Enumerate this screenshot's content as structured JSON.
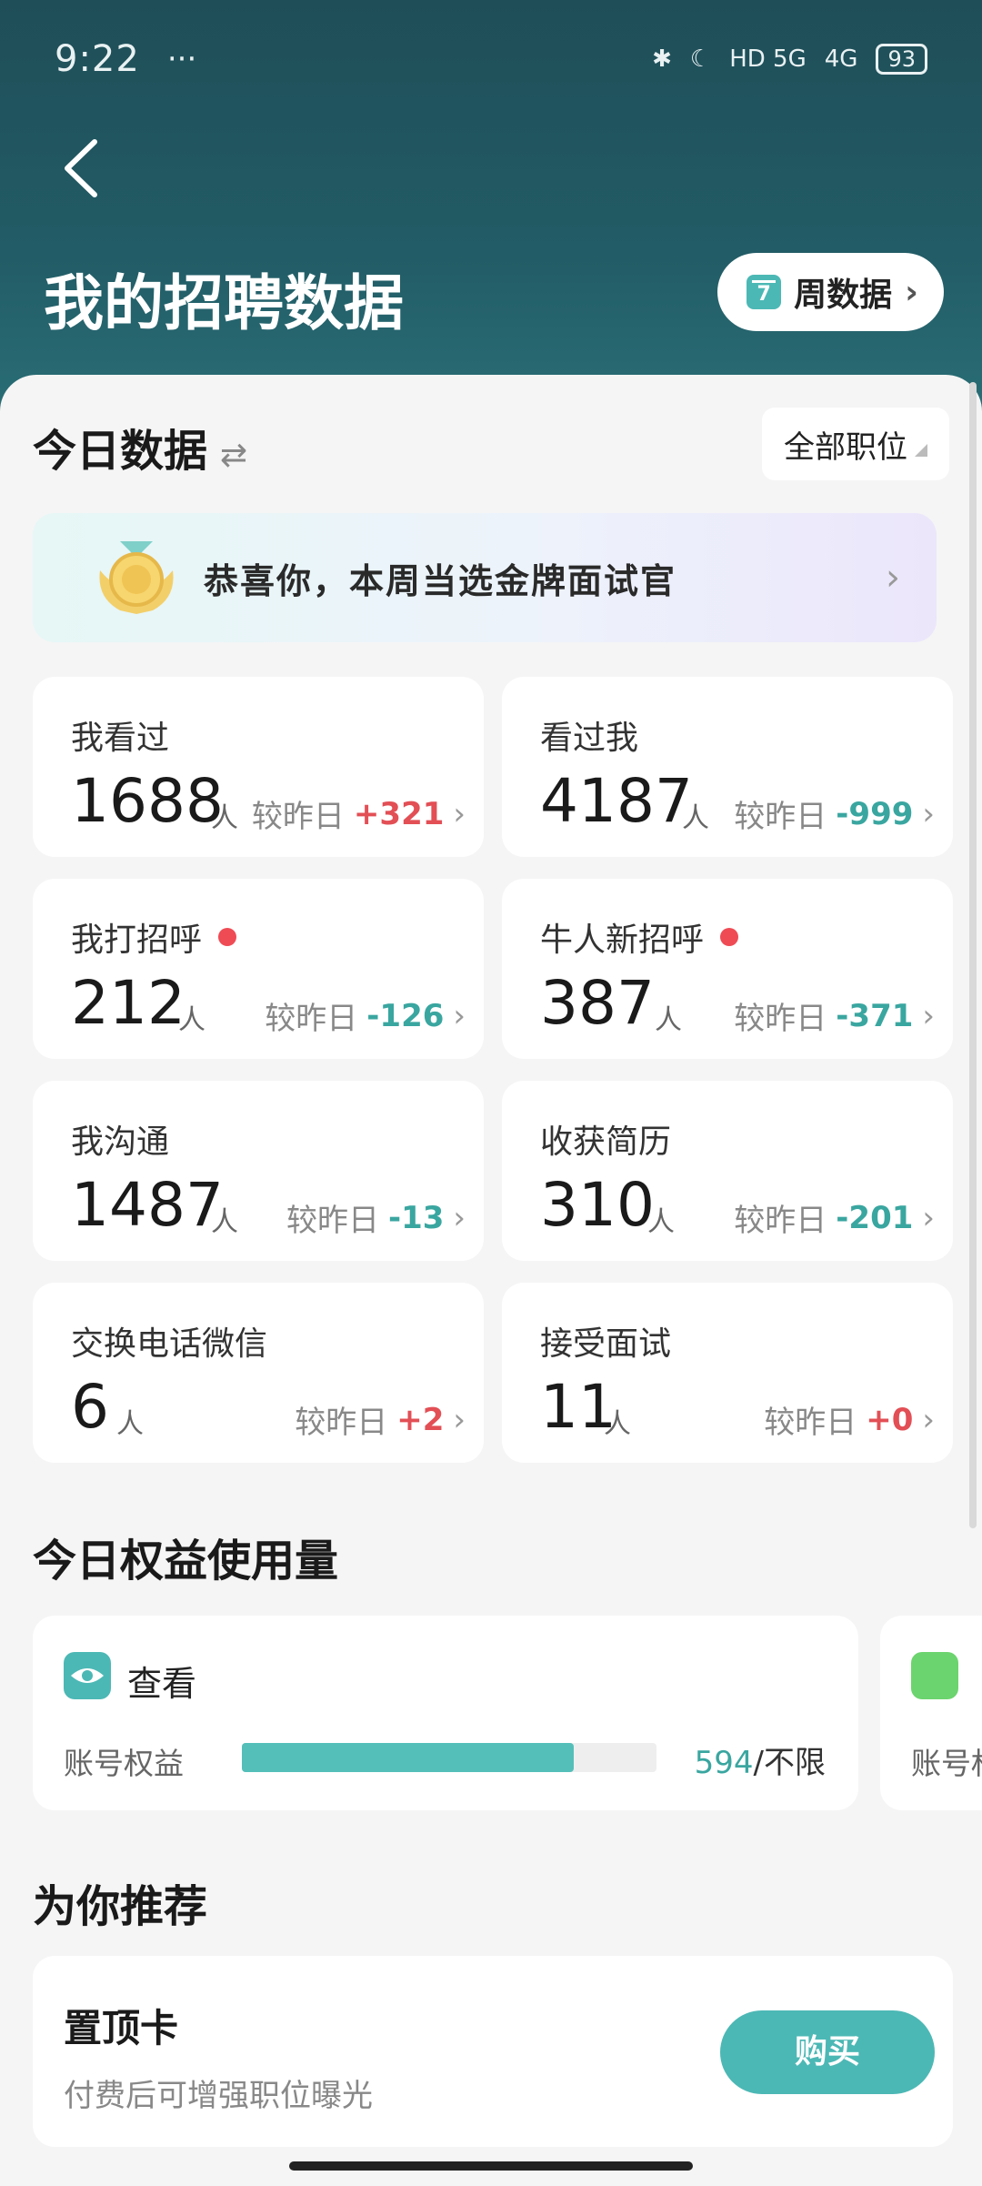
{
  "status_bar": {
    "time": "9:22",
    "more": "···",
    "network_1": "HD 5G",
    "network_2": "4G",
    "battery": "93"
  },
  "header": {
    "title": "我的招聘数据",
    "week_button": "周数据",
    "calendar_day": "7"
  },
  "today": {
    "section_title": "今日数据",
    "job_filter": "全部职位"
  },
  "banner": {
    "text": "恭喜你，本周当选金牌面试官"
  },
  "compare_label": "较昨日",
  "unit": "人",
  "stats": [
    {
      "label": "我看过",
      "value": "1688",
      "delta": "+321",
      "dot": false
    },
    {
      "label": "看过我",
      "value": "4187",
      "delta": "-999",
      "dot": false
    },
    {
      "label": "我打招呼",
      "value": "212",
      "delta": "-126",
      "dot": true
    },
    {
      "label": "牛人新招呼",
      "value": "387",
      "delta": "-371",
      "dot": true
    },
    {
      "label": "我沟通",
      "value": "1487",
      "delta": "-13",
      "dot": false
    },
    {
      "label": "收获简历",
      "value": "310",
      "delta": "-201",
      "dot": false
    },
    {
      "label": "交换电话微信",
      "value": "6",
      "delta": "+2",
      "dot": false
    },
    {
      "label": "接受面试",
      "value": "11",
      "delta": "+0",
      "dot": false
    }
  ],
  "benefits": {
    "section_title": "今日权益使用量",
    "card": {
      "title": "查看",
      "label": "账号权益",
      "used": "594",
      "limit": "/不限",
      "fill_fraction": 0.8
    },
    "next_card_label": "账号权"
  },
  "recommend": {
    "section_title": "为你推荐",
    "item": {
      "title": "置顶卡",
      "desc": "付费后可增强职位曝光",
      "button": "购买"
    }
  },
  "colors": {
    "accent": "#4cb8b5",
    "positive": "#e24f55",
    "negative": "#3aa6a0",
    "header_bg": "#1f4e58"
  }
}
